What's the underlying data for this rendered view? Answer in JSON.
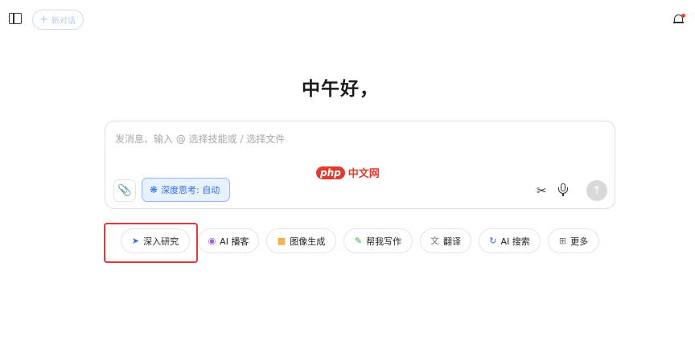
{
  "header": {
    "new_chat_label": "新对话"
  },
  "greeting": "中午好，",
  "input": {
    "placeholder": "发消息、输入 @ 选择技能或 / 选择文件",
    "deep_think_label": "深度思考: 自动"
  },
  "watermark": {
    "php": "php",
    "cn": "中文网"
  },
  "skills": [
    {
      "label": "深入研究",
      "icon": "telescope-icon",
      "color": "#2f6fe4"
    },
    {
      "label": "AI 播客",
      "icon": "podcast-icon",
      "color": "#9b5de5"
    },
    {
      "label": "图像生成",
      "icon": "image-gen-icon",
      "color": "#f08c00"
    },
    {
      "label": "帮我写作",
      "icon": "pen-icon",
      "color": "#2fb344"
    },
    {
      "label": "翻译",
      "icon": "translate-icon",
      "color": "#6b7280"
    },
    {
      "label": "AI 搜索",
      "icon": "search-refresh-icon",
      "color": "#2f6fe4"
    },
    {
      "label": "更多",
      "icon": "grid-icon",
      "color": "#6b7280"
    }
  ],
  "colors": {
    "accent": "#2f6fe4",
    "highlight": "#e8343c",
    "notification_dot": "#ff3b30"
  }
}
